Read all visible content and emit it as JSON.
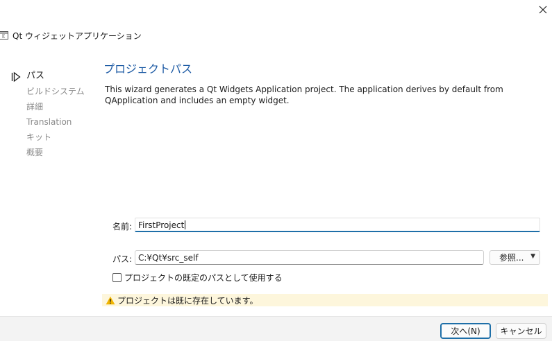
{
  "window": {
    "title": "Qt ウィジェットアプリケーション",
    "icon": "qt-app-icon"
  },
  "sidebar": {
    "items": [
      {
        "label": "パス",
        "state": "current"
      },
      {
        "label": "ビルドシステム",
        "state": "pending"
      },
      {
        "label": "詳細",
        "state": "pending"
      },
      {
        "label": "Translation",
        "state": "pending"
      },
      {
        "label": "キット",
        "state": "pending"
      },
      {
        "label": "概要",
        "state": "pending"
      }
    ],
    "current_indicator_icon": "play-arrow-icon"
  },
  "page": {
    "title": "プロジェクトパス",
    "description": "This wizard generates a Qt Widgets Application project. The application derives by default from QApplication and includes an empty widget."
  },
  "form": {
    "name_label": "名前:",
    "name_value": "FirstProject",
    "path_label": "パス:",
    "path_value": "C:¥Qt¥src_self",
    "browse_label": "参照...",
    "default_path_checkbox_label": "プロジェクトの既定のパスとして使用する",
    "default_path_checked": false
  },
  "warning": {
    "text": "プロジェクトは既に存在しています。",
    "icon": "warning-icon",
    "color": "#f0b400"
  },
  "footer": {
    "next_label": "次へ(N)",
    "cancel_label": "キャンセル"
  },
  "colors": {
    "accent": "#1e6fa8",
    "title": "#1f5ca5",
    "warning_bg": "#fdf6dc"
  }
}
